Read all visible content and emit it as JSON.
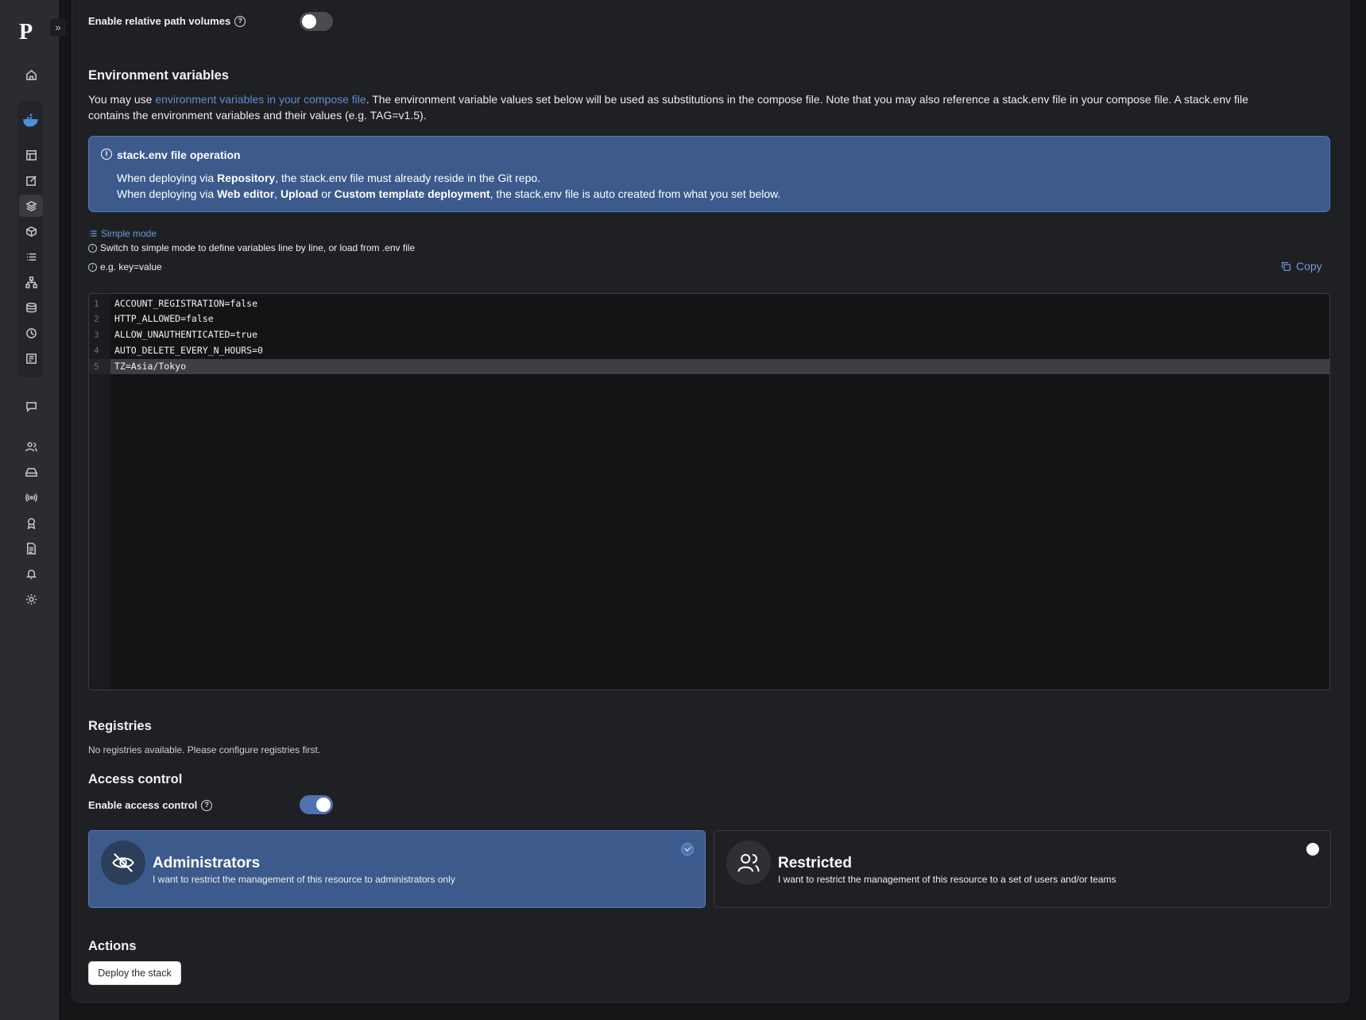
{
  "sidebar": {
    "logo": "P",
    "collapse_glyph": "»",
    "icons": [
      "home-icon",
      "docker-icon",
      "dashboard-icon",
      "edit-icon",
      "stacks-icon",
      "container-icon",
      "list-icon",
      "network-icon",
      "volume-icon",
      "history-icon",
      "registry-icon",
      "chat-icon",
      "users-icon",
      "drive-icon",
      "signal-icon",
      "badge-icon",
      "document-icon",
      "bell-icon",
      "settings-icon"
    ]
  },
  "relative_path": {
    "label": "Enable relative path volumes",
    "enabled": false
  },
  "env": {
    "title": "Environment variables",
    "desc_prefix": "You may use ",
    "desc_link": "environment variables in your compose file",
    "desc_suffix_1": ". The environment variable values set below will be used as substitutions in the compose file. Note that you may also reference a stack.env file in your compose file. A stack.env file",
    "desc_line2": "contains the environment variables and their values (e.g. TAG=v1.5).",
    "info": {
      "title": "stack.env file operation",
      "l1_a": "When deploying via ",
      "l1_b": "Repository",
      "l1_c": ", the stack.env file must already reside in the Git repo.",
      "l2_a": "When deploying via ",
      "l2_b": "Web editor",
      "l2_c": ", ",
      "l2_d": "Upload",
      "l2_e": " or ",
      "l2_f": "Custom template deployment",
      "l2_g": ", the stack.env file is auto created from what you set below."
    },
    "simple_mode": "Simple mode",
    "switch_hint": "Switch to simple mode to define variables line by line, or load from .env file",
    "example_hint": "e.g. key=value",
    "copy": "Copy",
    "lines": [
      {
        "n": "1",
        "t": "ACCOUNT_REGISTRATION=false"
      },
      {
        "n": "2",
        "t": "HTTP_ALLOWED=false"
      },
      {
        "n": "3",
        "t": "ALLOW_UNAUTHENTICATED=true"
      },
      {
        "n": "4",
        "t": "AUTO_DELETE_EVERY_N_HOURS=0"
      },
      {
        "n": "5",
        "t": "TZ=Asia/Tokyo"
      }
    ]
  },
  "registries": {
    "title": "Registries",
    "note": "No registries available. Please configure registries first."
  },
  "access": {
    "title": "Access control",
    "toggle_label": "Enable access control",
    "enabled": true,
    "admins": {
      "title": "Administrators",
      "desc": "I want to restrict the management of this resource to administrators only"
    },
    "restricted": {
      "title": "Restricted",
      "desc": "I want to restrict the management of this resource to a set of users and/or teams"
    }
  },
  "actions": {
    "title": "Actions",
    "deploy": "Deploy the stack"
  }
}
